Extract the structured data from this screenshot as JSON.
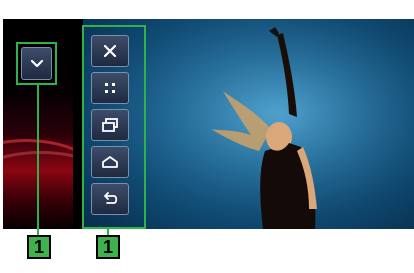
{
  "screen": {
    "left_panel": {
      "collapse_button": {
        "icon": "chevron-down-icon"
      }
    },
    "control_panel": {
      "buttons": [
        {
          "icon": "close-icon"
        },
        {
          "icon": "dots-grid-icon"
        },
        {
          "icon": "windows-icon"
        },
        {
          "icon": "home-icon"
        },
        {
          "icon": "back-arrow-icon"
        }
      ]
    },
    "video": {
      "description_hidden": true
    }
  },
  "callouts": {
    "label_left": "1",
    "label_right": "1"
  },
  "colors": {
    "callout_green": "#3fb14d",
    "outline_green": "#2fb24a",
    "button_fill": "#2a3650",
    "video_blue": "#1f6b9a"
  }
}
